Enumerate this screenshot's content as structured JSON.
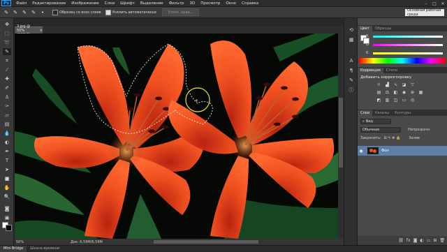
{
  "menubar": {
    "logo": "Ps",
    "items": [
      "Файл",
      "Редактирование",
      "Изображение",
      "Слои",
      "Шрифт",
      "Выделение",
      "Фильтр",
      "3D",
      "Просмотр",
      "Окно",
      "Справка"
    ]
  },
  "options": {
    "sample_all_layers": "Образец со всех слоев",
    "auto_enhance": "Усилить автоматически",
    "refine_edge": "Уточн. край...",
    "workspace": "Основная рабочая среда"
  },
  "document": {
    "tab_title": "3.jpg @ 50% (RGB/8)",
    "zoom": "50%",
    "doc_size": "Док: 6,59M/6,59M"
  },
  "bottom_tabs": [
    "Mini Bridge",
    "Шкала времени"
  ],
  "color_panel": {
    "tabs": [
      "Цвет",
      "Образцы"
    ],
    "sliders": [
      "R",
      "G",
      "B"
    ]
  },
  "adjustments_panel": {
    "tabs": [
      "Коррекция",
      "Стили"
    ],
    "title": "Добавить корректировку"
  },
  "layers_panel": {
    "tabs": [
      "Слои",
      "Каналы",
      "Контуры"
    ],
    "kind": "Вид",
    "blend_mode": "Обычные",
    "opacity_label": "Непрозрачн",
    "lock_label": "Закрепить:",
    "fill_label": "Залив",
    "layer_name": "Фон"
  },
  "colors": {
    "accent": "#31a8ff",
    "selected_layer": "#5b7fa8",
    "petal": "#f05020"
  },
  "icons": [
    "move-icon",
    "marquee-icon",
    "lasso-icon",
    "quick-selection-icon",
    "crop-icon",
    "eyedropper-icon",
    "healing-icon",
    "brush-icon",
    "stamp-icon",
    "history-brush-icon",
    "eraser-icon",
    "gradient-icon",
    "blur-icon",
    "dodge-icon",
    "pen-icon",
    "type-icon",
    "path-selection-icon",
    "shape-icon",
    "hand-icon",
    "zoom-icon"
  ]
}
